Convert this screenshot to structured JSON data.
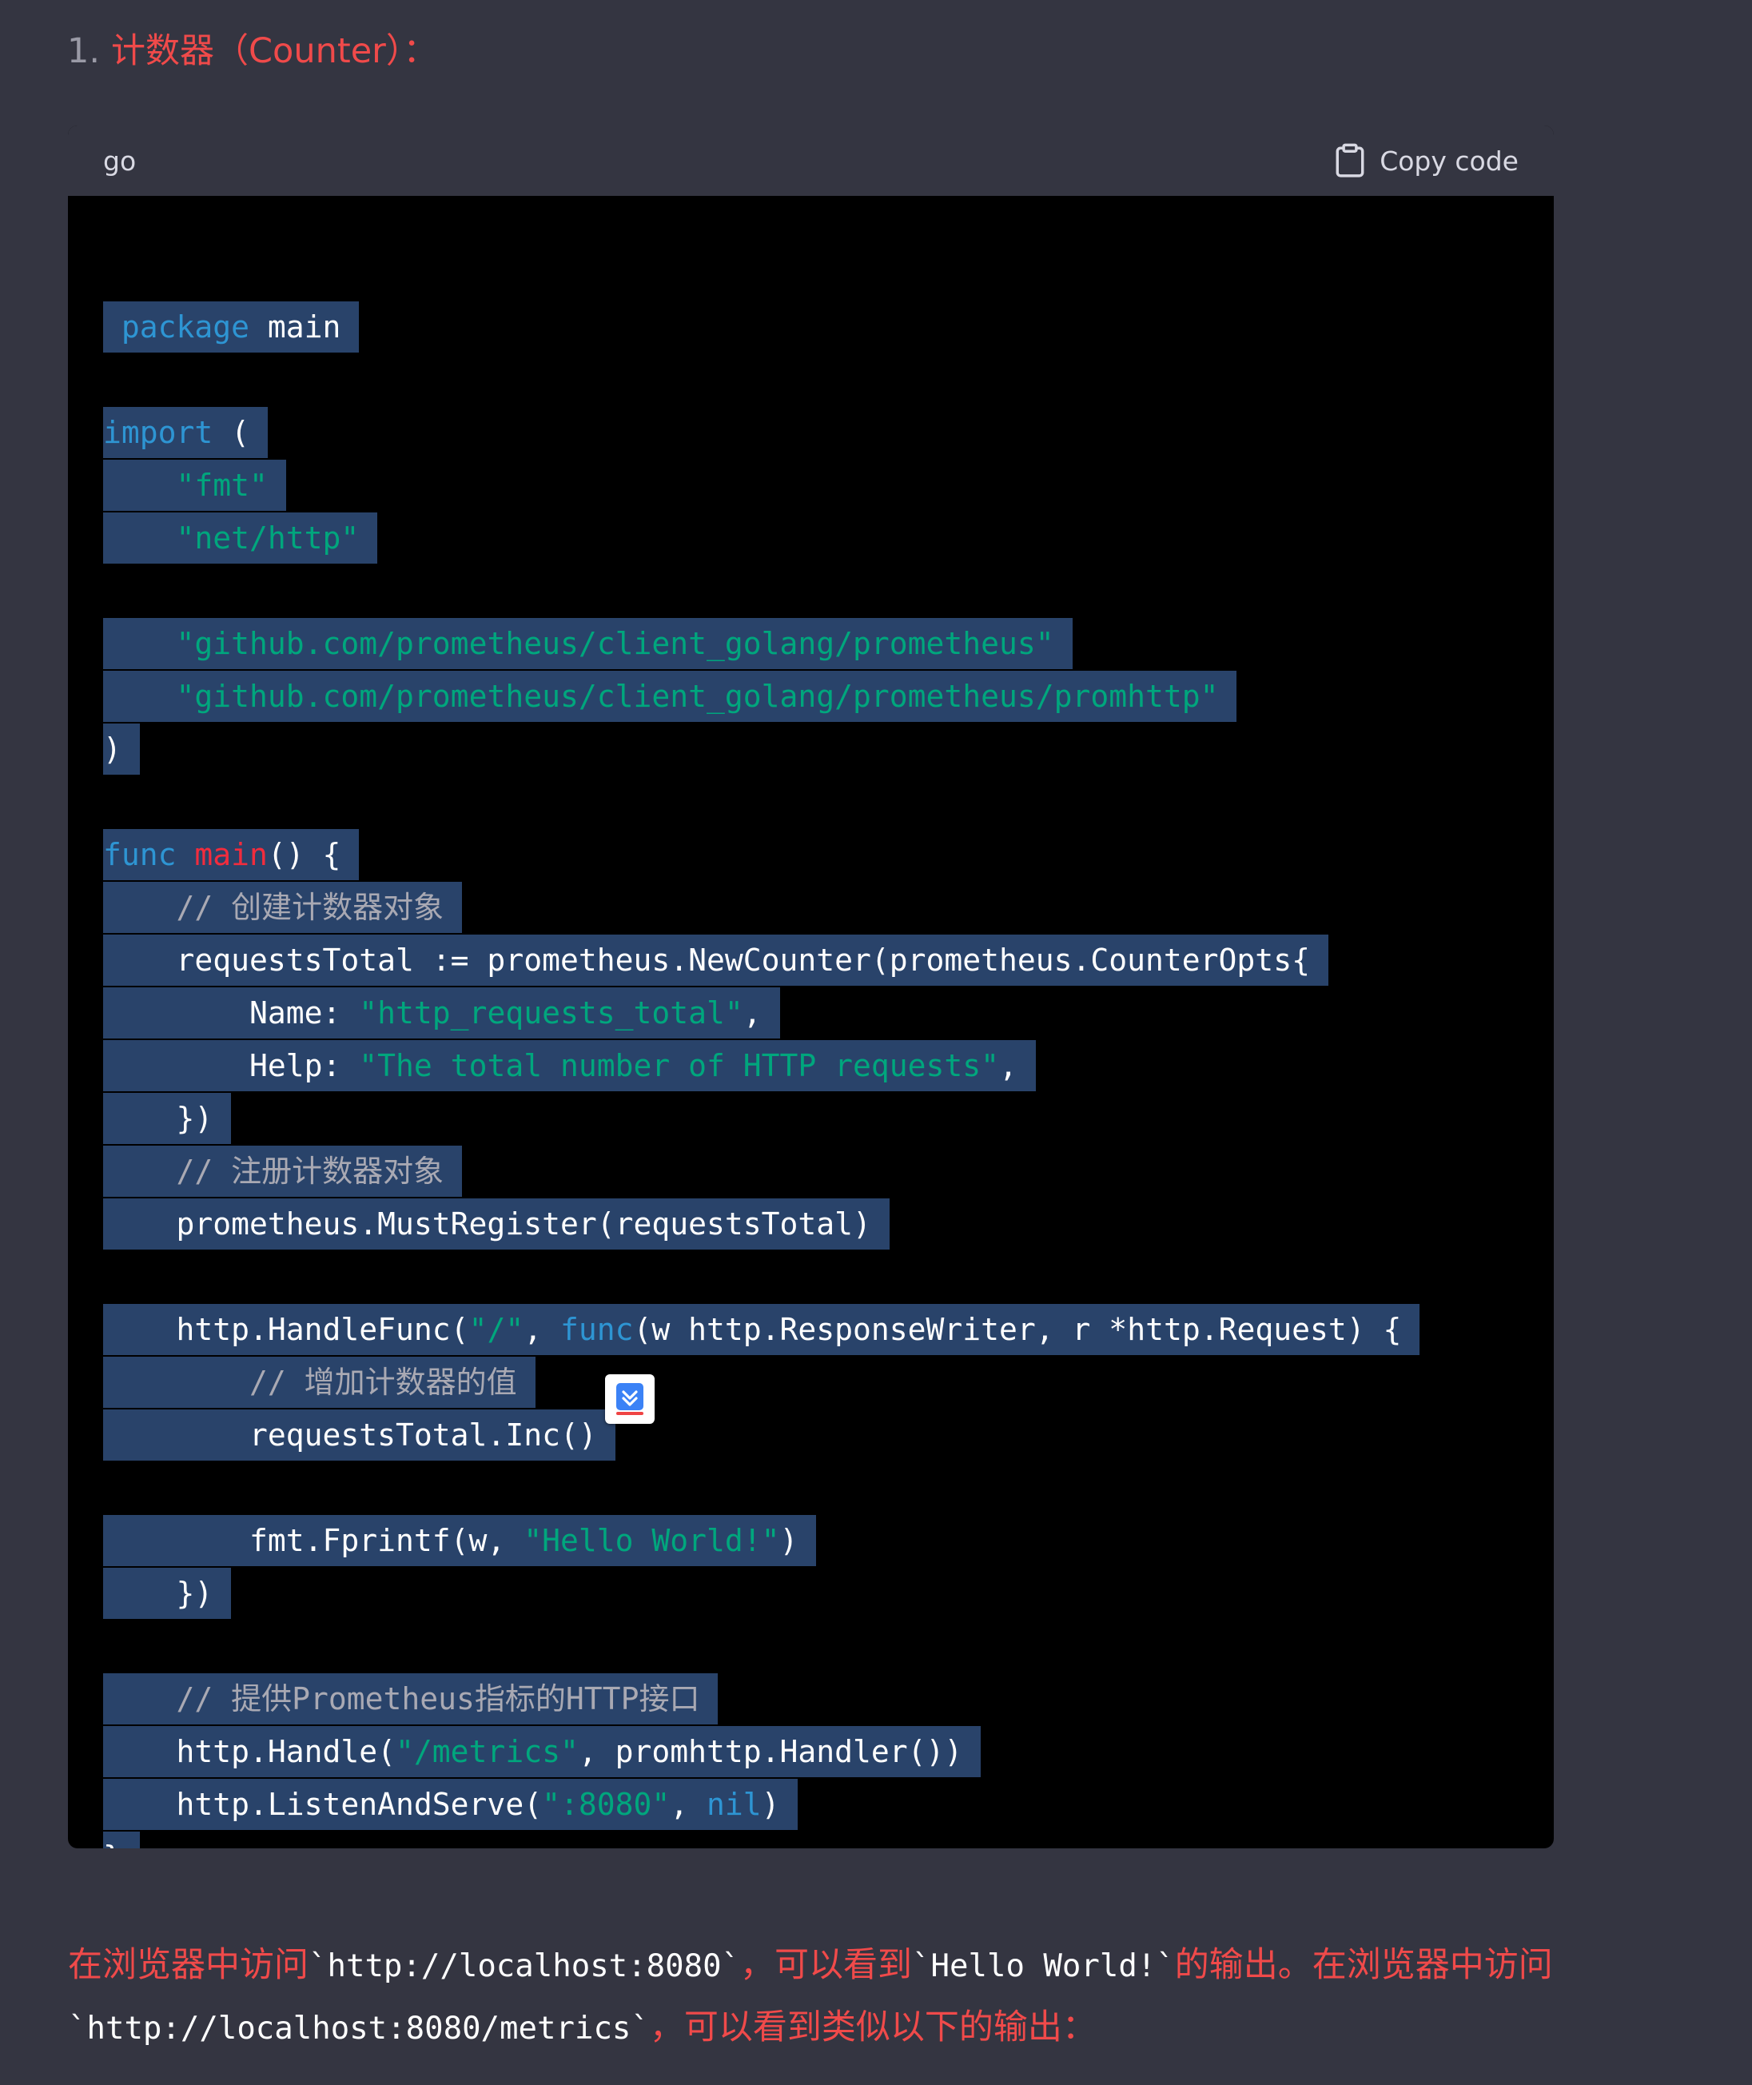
{
  "heading": {
    "number": "1.",
    "text": "计数器（Counter）："
  },
  "code_block": {
    "language": "go",
    "copy_label": "Copy code",
    "lines": [
      "package main",
      "",
      "import (",
      "    \"fmt\"",
      "    \"net/http\"",
      "",
      "    \"github.com/prometheus/client_golang/prometheus\"",
      "    \"github.com/prometheus/client_golang/prometheus/promhttp\"",
      ")",
      "",
      "func main() {",
      "    // 创建计数器对象",
      "    requestsTotal := prometheus.NewCounter(prometheus.CounterOpts{",
      "        Name: \"http_requests_total\",",
      "        Help: \"The total number of HTTP requests\",",
      "    })",
      "    // 注册计数器对象",
      "    prometheus.MustRegister(requestsTotal)",
      "",
      "    http.HandleFunc(\"/\", func(w http.ResponseWriter, r *http.Request) {",
      "        // 增加计数器的值",
      "        requestsTotal.Inc()",
      "",
      "        fmt.Fprintf(w, \"Hello World!\")",
      "    })",
      "",
      "    // 提供Prometheus指标的HTTP接口",
      "    http.Handle(\"/metrics\", promhttp.Handler())",
      "    http.ListenAndServe(\":8080\", nil)",
      "}"
    ]
  },
  "paragraph": {
    "p1": "在浏览器中访问",
    "c1": "`http://localhost:8080`",
    "p2": "，可以看到",
    "c2": "`Hello World!`",
    "p3": "的输出。在浏览器中访问",
    "c3": "`http://localhost:8080/metrics`",
    "p4": "，可以看到类似以下的输出："
  },
  "icons": {
    "copy": "clipboard-icon",
    "extension": "translate-extension-icon"
  },
  "colors": {
    "background": "#343541",
    "code_background": "#000000",
    "selection": "#29436a",
    "keyword": "#2e95d3",
    "string": "#00a67d",
    "function_name": "#f22c3d",
    "comment": "#a9a9b3",
    "red_text": "#f04a4a"
  }
}
